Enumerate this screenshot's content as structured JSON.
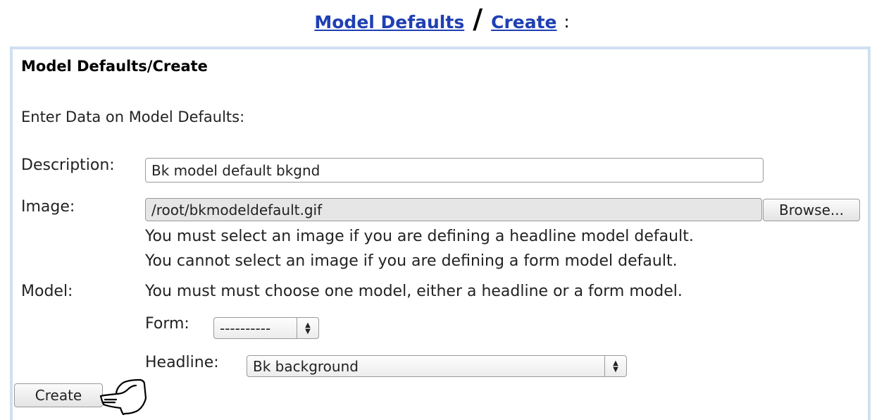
{
  "breadcrumb": {
    "link1": "Model Defaults",
    "separator": "/",
    "link2": "Create",
    "colon": ":"
  },
  "panel": {
    "title": "Model Defaults/Create",
    "intro": "Enter Data on Model Defaults:"
  },
  "form": {
    "description_label": "Description:",
    "description_value": "Bk model default bkgnd",
    "image_label": "Image:",
    "image_value": "/root/bkmodeldefault.gif",
    "browse_label": "Browse...",
    "image_note_1": "You must select an image if you are defining a headline model default.",
    "image_note_2": "You cannot select an image if you are defining a form model default.",
    "model_label": "Model:",
    "model_note": "You must must choose one model, either a headline or a form model.",
    "form_label": "Form:",
    "form_value": "----------",
    "headline_label": "Headline:",
    "headline_value": "Bk background",
    "create_label": "Create"
  },
  "icons": {
    "select_arrows": "up-down-arrows-icon",
    "cursor": "pointing-hand-icon"
  },
  "colors": {
    "link": "#1f3fb3",
    "panel_border": "#cfe0ef"
  }
}
